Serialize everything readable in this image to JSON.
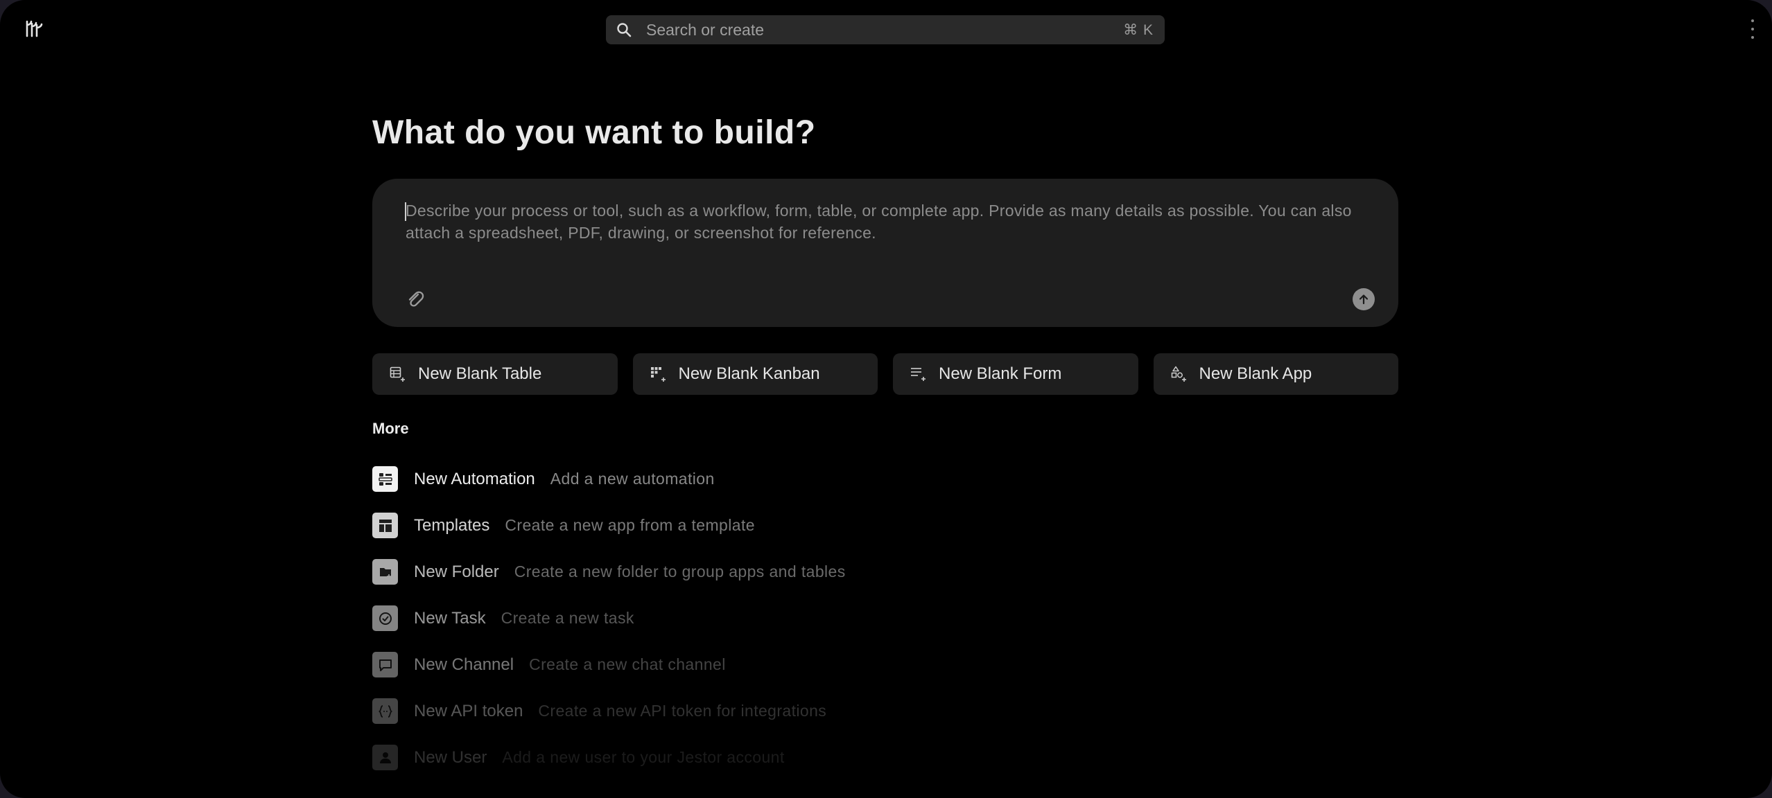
{
  "topbar": {
    "logo_icon": "tadabase-logo-icon",
    "search": {
      "placeholder": "Search or create",
      "shortcut": "⌘ K",
      "icon": "search-icon"
    },
    "menu_icon": "more-vertical-icon"
  },
  "main": {
    "headline": "What do you want to build?",
    "prompt": {
      "placeholder": "Describe your process or tool, such as a workflow, form, table, or complete app. Provide as many details as possible. You can also attach a spreadsheet, PDF, drawing, or screenshot for reference.",
      "attach_icon": "paperclip-icon",
      "send_icon": "arrow-up-icon"
    },
    "quick_actions": [
      {
        "label": "New Blank Table",
        "icon": "table-plus-icon"
      },
      {
        "label": "New Blank Kanban",
        "icon": "kanban-plus-icon"
      },
      {
        "label": "New Blank Form",
        "icon": "form-plus-icon"
      },
      {
        "label": "New Blank App",
        "icon": "app-shapes-plus-icon"
      }
    ],
    "more_title": "More",
    "more_items": [
      {
        "label": "New Automation",
        "description": "Add a new automation",
        "icon": "automation-icon"
      },
      {
        "label": "Templates",
        "description": "Create a new app from a template",
        "icon": "template-layout-icon"
      },
      {
        "label": "New Folder",
        "description": "Create a new folder to group apps and tables",
        "icon": "folder-icon"
      },
      {
        "label": "New Task",
        "description": "Create a new task",
        "icon": "check-circle-icon"
      },
      {
        "label": "New Channel",
        "description": "Create a new chat channel",
        "icon": "chat-bubble-icon"
      },
      {
        "label": "New API token",
        "description": "Create a new API token for integrations",
        "icon": "api-braces-icon"
      },
      {
        "label": "New User",
        "description": "Add a new user to your Jestor account",
        "icon": "user-icon"
      }
    ]
  },
  "colors": {
    "background": "#000000",
    "surface": "#1e1e1e",
    "search_surface": "#2a2a2a",
    "text_primary": "#e9e9e9",
    "text_muted": "#8c8c8c"
  }
}
